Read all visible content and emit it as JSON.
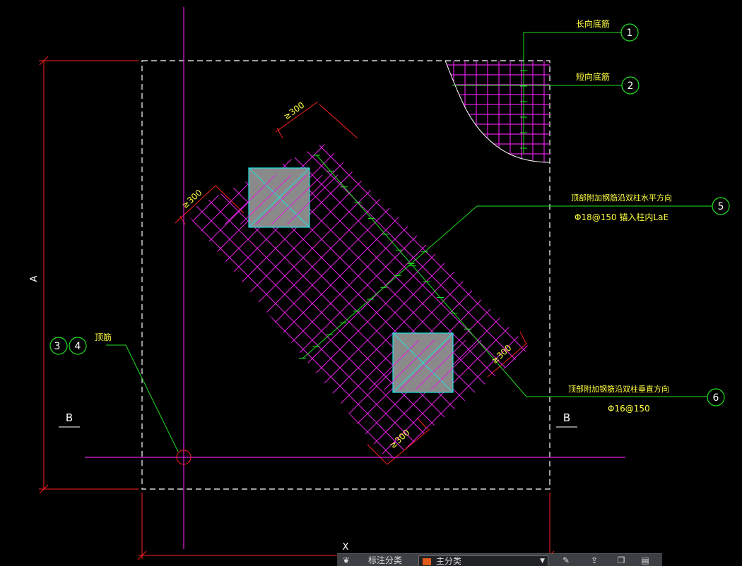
{
  "drawing": {
    "dimensions": {
      "vertical_A": "A",
      "horizontal_X": "X",
      "min_300": "≥300"
    },
    "section_marks": {
      "left": "B",
      "right": "B"
    },
    "callouts": [
      {
        "num": "1",
        "label": "长向底筋"
      },
      {
        "num": "2",
        "label": "短向底筋"
      },
      {
        "num": "3",
        "label": ""
      },
      {
        "num": "4",
        "label": "顶筋"
      },
      {
        "num": "5",
        "label": "顶部附加钢筋沿双柱水平方向",
        "spec": "Φ18@150 锚入柱内LaE"
      },
      {
        "num": "6",
        "label": "顶部附加钢筋沿双柱垂直方向",
        "spec": "Φ16@150"
      }
    ],
    "colors": {
      "background": "#000000",
      "dimension": "#ff2020",
      "rebar": "#e020e0",
      "leader": "#20e020",
      "outline": "#ffffff",
      "column_fill": "#8a8a8a",
      "column_edge": "#20e0e0",
      "text": "#ffff40",
      "circle": "#20e020"
    }
  },
  "toolbar": {
    "layer_icon": "layer-icon",
    "annotation_label": "标注分类",
    "layer_value": "主分类",
    "icons": [
      "edit-icon",
      "upload-icon",
      "copy-icon",
      "clipboard-icon"
    ]
  }
}
